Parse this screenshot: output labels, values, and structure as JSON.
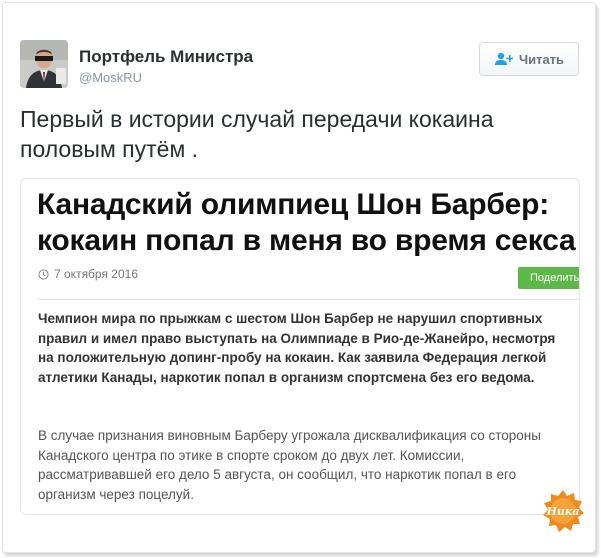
{
  "user": {
    "name": "Портфель Министра",
    "handle": "@MoskRU"
  },
  "follow_button": {
    "label": "Читать",
    "icon": "add-user-icon"
  },
  "tweet": {
    "text": "Первый в истории случай передачи кокаина половым путём ."
  },
  "card": {
    "headline": "Канадский олимпиец Шон Барбер: кокаин попал в меня во время секса",
    "date": "7 октября 2016",
    "share_label": "Поделиться",
    "lead": "Чемпион мира по прыжкам с шестом Шон Барбер не нарушил спортивных правил и имел право выступать на Олимпиаде в Рио-де-Жанейро, несмотря на положительную допинг-пробу на кокаин. Как заявила Федерация легкой атлетики Канады, наркотик попал в организм спортсмена без его ведома.",
    "body": "В случае признания виновным Барберу угрожала дисквалификация со стороны Канадского центра по этике в спорте сроком до двух лет. Комиссии, рассматривавшей его дело 5 августа, он сообщил, что наркотик попал в его организм через поцелуй."
  },
  "watermark": {
    "text": "Ника"
  },
  "colors": {
    "share_green": "#5cb947",
    "handle_gray": "#8899a6",
    "watermark_orange": "#f08a1c"
  }
}
